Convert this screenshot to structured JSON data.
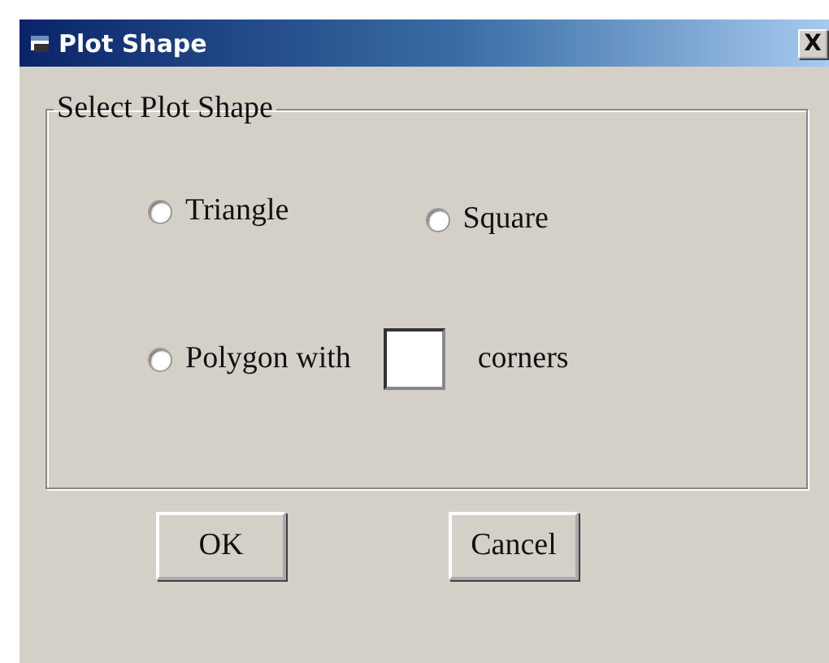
{
  "window": {
    "title": "Plot Shape",
    "close": "X"
  },
  "group": {
    "legend": "Select Plot Shape",
    "options": [
      {
        "kind": "radio",
        "label": "Triangle",
        "selected": false
      },
      {
        "kind": "radio",
        "label": "Square",
        "selected": false
      },
      {
        "kind": "polygon",
        "label": "Polygon with",
        "suffix": "corners",
        "selected": false
      }
    ]
  },
  "buttons": [
    "OK",
    "Cancel"
  ]
}
